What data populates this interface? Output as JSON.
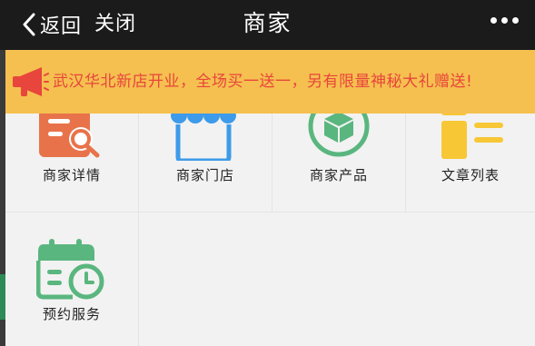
{
  "header": {
    "back_label": "返回",
    "close_label": "关闭",
    "title": "商家"
  },
  "banner": {
    "text": "武汉华北新店开业，全场买一送一，另有限量神秘大礼赠送!",
    "icon": "megaphone-icon"
  },
  "grid": {
    "items": [
      {
        "label": "商家详情",
        "icon": "store-details-icon",
        "color": "#e8734a"
      },
      {
        "label": "商家门店",
        "icon": "storefront-icon",
        "color": "#3d9be9"
      },
      {
        "label": "商家产品",
        "icon": "product-box-icon",
        "color": "#5ab67f"
      },
      {
        "label": "文章列表",
        "icon": "article-list-icon",
        "color": "#f7c736"
      },
      {
        "label": "预约服务",
        "icon": "calendar-clock-icon",
        "color": "#5ab67f"
      }
    ]
  },
  "colors": {
    "header_bg": "#1b1b1c",
    "banner_bg": "#f5c04f",
    "banner_text": "#e8453c",
    "page_bg": "#f2f2f2"
  }
}
